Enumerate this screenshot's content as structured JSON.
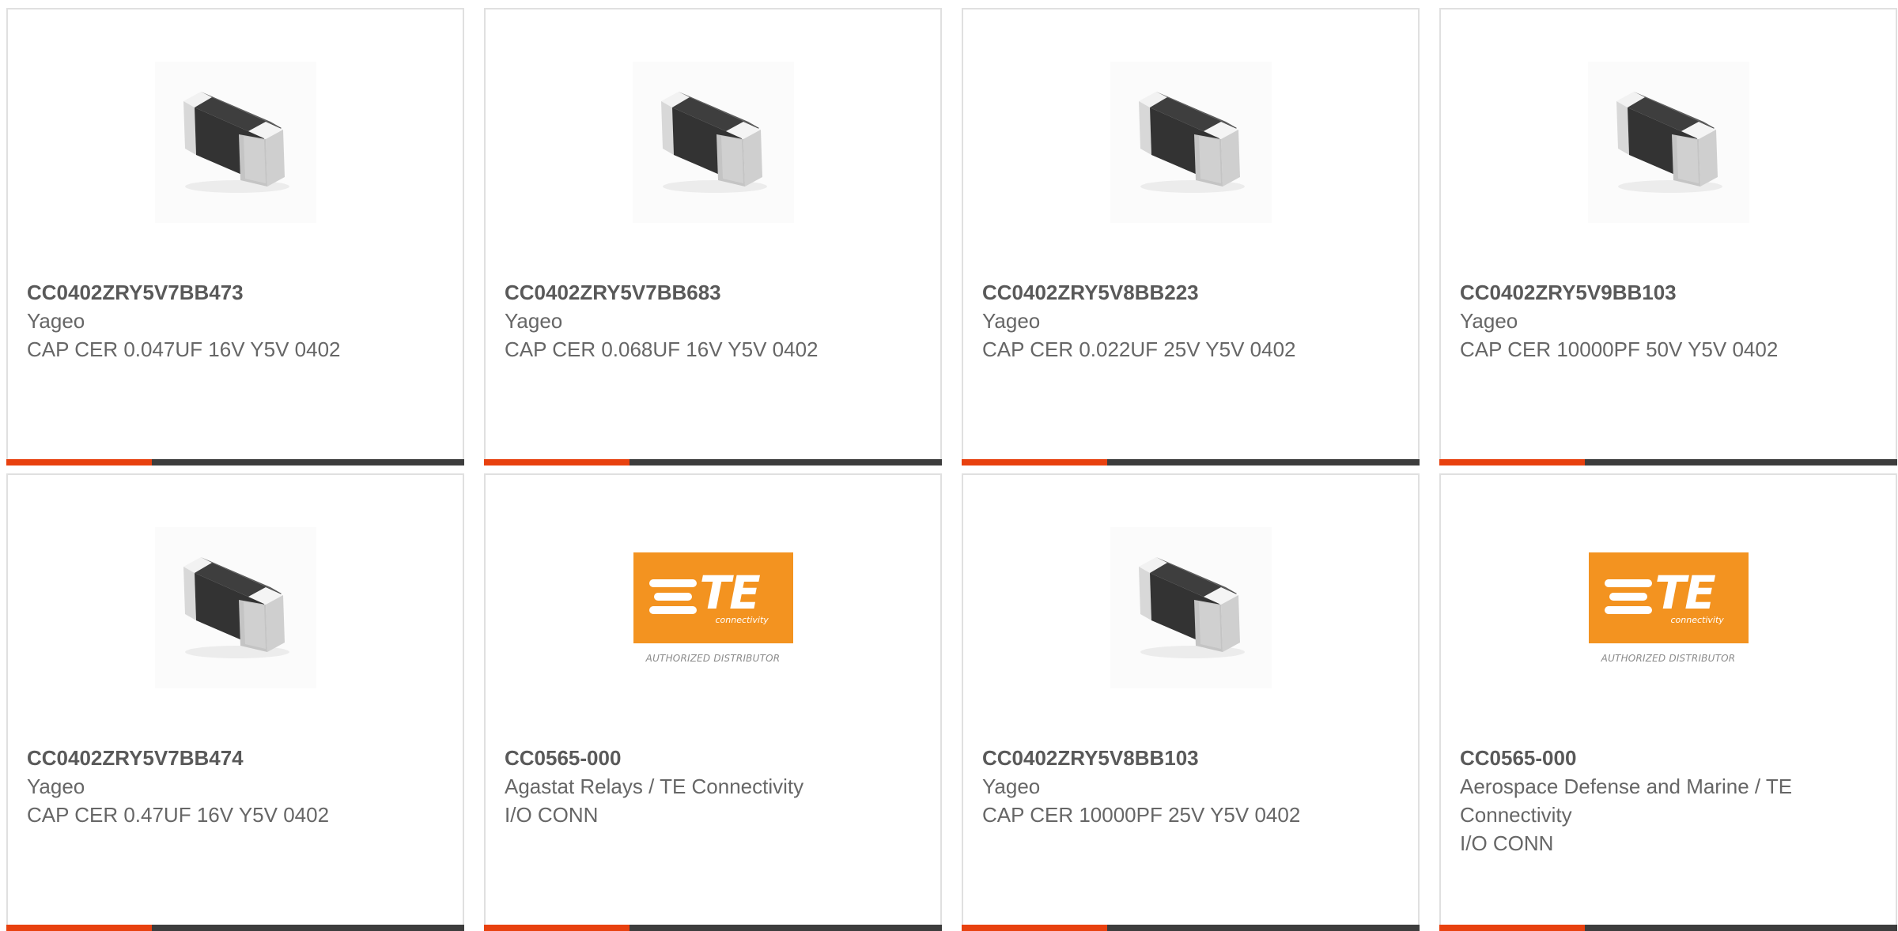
{
  "products": [
    {
      "part_number": "CC0402ZRY5V7BB473",
      "manufacturer": "Yageo",
      "description": "CAP CER 0.047UF 16V Y5V 0402",
      "image": "capacitor-chip"
    },
    {
      "part_number": "CC0402ZRY5V7BB683",
      "manufacturer": "Yageo",
      "description": "CAP CER 0.068UF 16V Y5V 0402",
      "image": "capacitor-chip"
    },
    {
      "part_number": "CC0402ZRY5V8BB223",
      "manufacturer": "Yageo",
      "description": "CAP CER 0.022UF 25V Y5V 0402",
      "image": "capacitor-chip"
    },
    {
      "part_number": "CC0402ZRY5V9BB103",
      "manufacturer": "Yageo",
      "description": "CAP CER 10000PF 50V Y5V 0402",
      "image": "capacitor-chip"
    },
    {
      "part_number": "CC0402ZRY5V7BB474",
      "manufacturer": "Yageo",
      "description": "CAP CER 0.47UF 16V Y5V 0402",
      "image": "capacitor-chip"
    },
    {
      "part_number": "CC0565-000",
      "manufacturer": "Agastat Relays / TE Connectivity",
      "description": "I/O CONN",
      "image": "te-logo"
    },
    {
      "part_number": "CC0402ZRY5V8BB103",
      "manufacturer": "Yageo",
      "description": "CAP CER 10000PF 25V Y5V 0402",
      "image": "capacitor-chip"
    },
    {
      "part_number": "CC0565-000",
      "manufacturer": "Aerospace Defense and Marine / TE Connectivity",
      "description": "I/O CONN",
      "image": "te-logo"
    }
  ],
  "te_logo": {
    "letters": "TE",
    "subtitle": "connectivity",
    "tagline": "AUTHORIZED DISTRIBUTOR"
  },
  "colors": {
    "accent_orange": "#e8410f",
    "bar_dark": "#3d3d3d",
    "te_orange": "#f39320",
    "card_border": "#e0e0e0",
    "text": "#666666"
  }
}
